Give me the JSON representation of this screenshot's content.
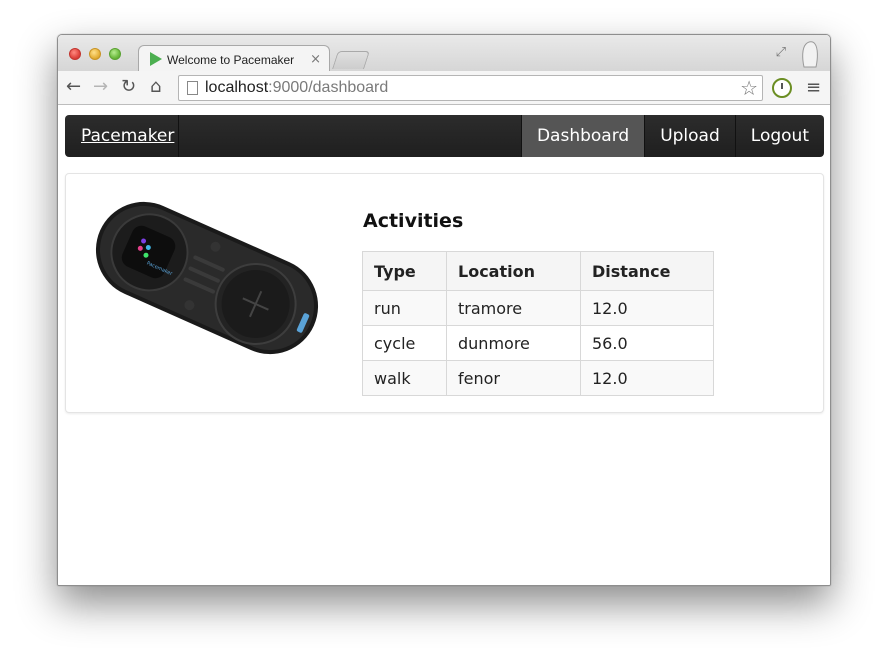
{
  "browser": {
    "tab_title": "Welcome to Pacemaker",
    "tab_close": "×",
    "url_host": "localhost",
    "url_rest": ":9000/dashboard",
    "icons": [
      "back-icon",
      "forward-icon",
      "reload-icon",
      "home-icon",
      "page-icon",
      "star-icon",
      "clock-extension-icon",
      "menu-icon",
      "fullscreen-icon",
      "profile-icon"
    ]
  },
  "navbar": {
    "brand": "Pacemaker",
    "items": [
      {
        "label": "Dashboard",
        "active": true
      },
      {
        "label": "Upload",
        "active": false
      },
      {
        "label": "Logout",
        "active": false
      }
    ]
  },
  "main": {
    "device_image_label": "Pacemaker",
    "section_title": "Activities",
    "table": {
      "headers": [
        "Type",
        "Location",
        "Distance"
      ],
      "rows": [
        [
          "run",
          "tramore",
          "12.0"
        ],
        [
          "cycle",
          "dunmore",
          "56.0"
        ],
        [
          "walk",
          "fenor",
          "12.0"
        ]
      ]
    }
  },
  "colors": {
    "navbar_bg": "#222222",
    "nav_active_bg": "#555555",
    "favicon_green": "#4caf50"
  }
}
